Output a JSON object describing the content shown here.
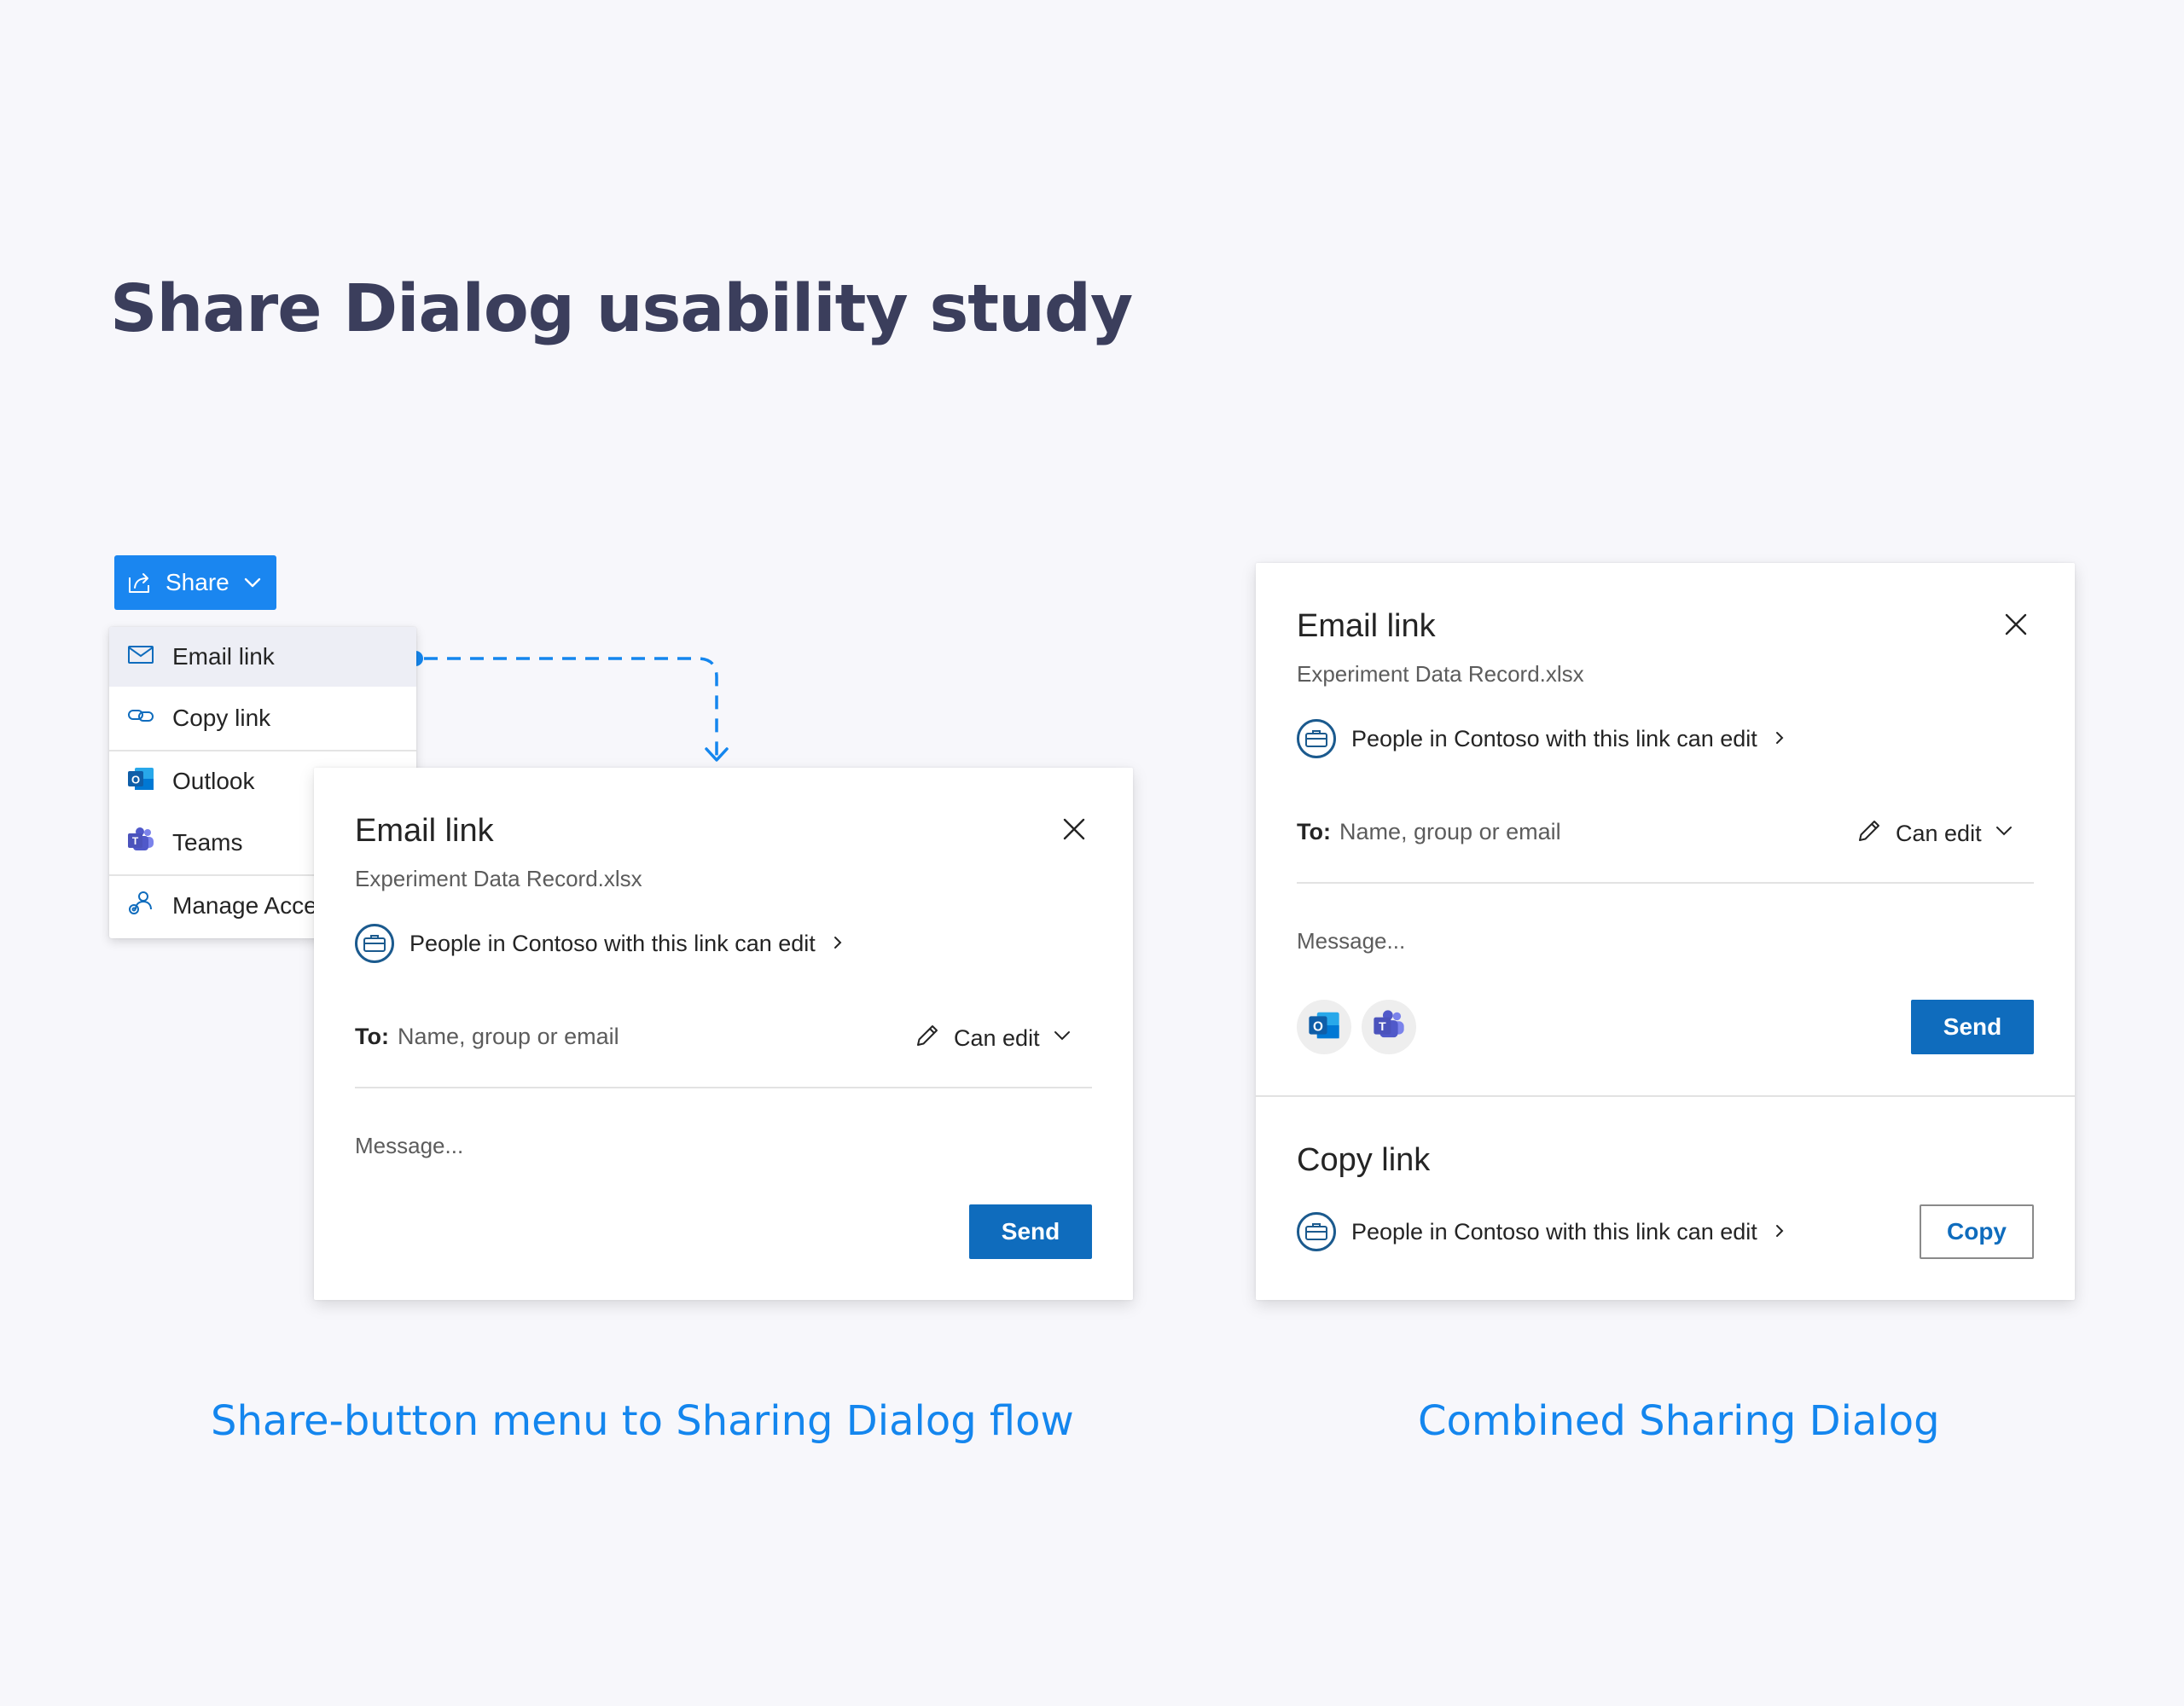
{
  "page": {
    "title": "Share Dialog usability study",
    "caption_left": "Share-button menu to Sharing Dialog flow",
    "caption_right": "Combined Sharing Dialog"
  },
  "share_button": {
    "label": "Share",
    "icon": "share-icon",
    "color": "#1a86f0"
  },
  "share_menu": {
    "items": [
      {
        "label": "Email link",
        "icon": "mail-icon",
        "active": true
      },
      {
        "label": "Copy link",
        "icon": "link-icon"
      },
      {
        "label": "Outlook",
        "icon": "outlook-icon"
      },
      {
        "label": "Teams",
        "icon": "teams-icon"
      },
      {
        "label": "Manage Acce",
        "icon": "manage-access-icon"
      }
    ]
  },
  "email_dialog": {
    "title": "Email link",
    "filename": "Experiment Data Record.xlsx",
    "permission_text": "People in Contoso with this link can edit",
    "to_label": "To:",
    "to_placeholder": "Name, group or email",
    "can_edit_label": "Can edit",
    "message_placeholder": "Message...",
    "send_label": "Send"
  },
  "combined_dialog": {
    "title": "Email link",
    "filename": "Experiment Data Record.xlsx",
    "permission_text": "People in Contoso with this link can edit",
    "to_label": "To:",
    "to_placeholder": "Name, group or email",
    "can_edit_label": "Can edit",
    "message_placeholder": "Message...",
    "send_label": "Send",
    "apps": [
      "outlook-icon",
      "teams-icon"
    ],
    "copy_section": {
      "title": "Copy link",
      "permission_text": "People in Contoso with this link can edit",
      "copy_label": "Copy"
    }
  },
  "colors": {
    "accent": "#1486ee",
    "primary_button": "#0f6cbd",
    "title_text": "#3b3e5c",
    "background": "#f7f7fb"
  }
}
